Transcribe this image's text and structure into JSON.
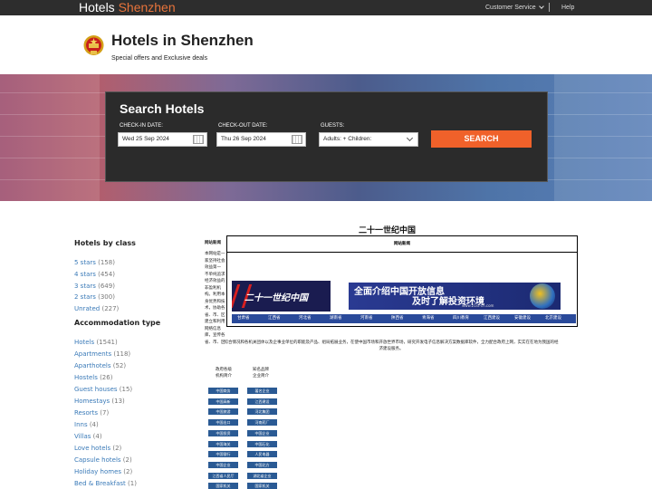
{
  "topbar": {
    "brand_main": "Hotels ",
    "brand_accent": "Shenzhen",
    "customer_service": "Customer Service",
    "help": "Help"
  },
  "header": {
    "title": "Hotels in Shenzhen",
    "tagline": "Special offers and  Exclusive deals"
  },
  "search": {
    "heading": "Search Hotels",
    "checkin_label": "CHECK-IN DATE:",
    "checkin_value": "Wed 25 Sep 2024",
    "checkout_label": "CHECK-OUT DATE:",
    "checkout_value": "Thu 26 Sep 2024",
    "guests_label": "GUESTS:",
    "guests_value": "Adults: + Children:",
    "button": "SEARCH"
  },
  "sidebar": {
    "class_heading": "Hotels by class",
    "classes": [
      {
        "label": "5 stars",
        "count": "(158)"
      },
      {
        "label": "4 stars",
        "count": "(454)"
      },
      {
        "label": "3 stars",
        "count": "(649)"
      },
      {
        "label": "2 stars",
        "count": "(300)"
      },
      {
        "label": "Unrated",
        "count": "(227)"
      }
    ],
    "type_heading": "Accommodation type",
    "types": [
      {
        "label": "Hotels",
        "count": "(1541)"
      },
      {
        "label": "Apartments",
        "count": "(118)"
      },
      {
        "label": "Aparthotels",
        "count": "(52)"
      },
      {
        "label": "Hostels",
        "count": "(26)"
      },
      {
        "label": "Guest houses",
        "count": "(15)"
      },
      {
        "label": "Homestays",
        "count": "(13)"
      },
      {
        "label": "Resorts",
        "count": "(7)"
      },
      {
        "label": "Inns",
        "count": "(4)"
      },
      {
        "label": "Villas",
        "count": "(4)"
      },
      {
        "label": "Love hotels",
        "count": "(2)"
      },
      {
        "label": "Capsule hotels",
        "count": "(2)"
      },
      {
        "label": "Holiday homes",
        "count": "(2)"
      },
      {
        "label": "Bed & Breakfast",
        "count": "(1)"
      }
    ]
  },
  "content": {
    "title": "二十一世纪中国",
    "left_label": "网站新闻",
    "frame_header": "网站新闻",
    "intro_lines": [
      "本网站是一",
      "家坚持社会",
      "效益第一",
      "不单纯追求",
      "经济效益的",
      "非盈利机",
      "构。利用本",
      "身优势和技",
      "术，协助各",
      "省、市、区",
      "建立和利用",
      "网络信息",
      "库，宣传各",
      "省、市、区"
    ],
    "banner1_text": "二十一世纪中国",
    "banner2_line1": "全面介绍中国开放信息",
    "banner2_line2": "及时了解投资环境",
    "banner2_url": "www.21st-cn.com",
    "nav": [
      "甘肃省",
      "江西省",
      "河北省",
      "湖南省",
      "河南省",
      "陕西省",
      "青海省",
      "四川教育",
      "江西建设",
      "安徽建设",
      "北京建设"
    ],
    "body_line1": "综合情况和各机关团体以及企事业单位的职能及产品、组局拓展业务，在使中国市场和开放世界市场，研究开发电子信息解决方案数据库软件，全力配合政府上网，实实在在地为我国的经",
    "body_line2": "济建设服务。",
    "col1_heading": [
      "政府各级",
      "机构简介"
    ],
    "col2_heading": [
      "知名品牌",
      "企业简介"
    ],
    "col1_buttons": [
      "中国商务",
      "中国高新",
      "中国旅游",
      "中国出口",
      "中国投资",
      "中国海关",
      "中国银行",
      "中国企业",
      "江西省人民厅",
      "国家机关"
    ],
    "col2_buttons": [
      "著名企业",
      "江西建设",
      "河北集团",
      "河南药厂",
      "中国企业",
      "中国石化",
      "人民电器",
      "中国北方",
      "湖北省企业",
      "国家机关"
    ]
  }
}
